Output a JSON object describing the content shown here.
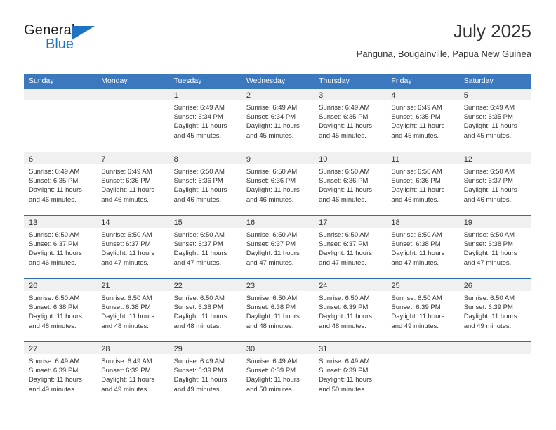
{
  "logo": {
    "word_top": "General",
    "word_bottom": "Blue",
    "icon": "triangle-mark",
    "accent_color": "#1f73c4"
  },
  "header": {
    "title": "July 2025",
    "subtitle": "Panguna, Bougainville, Papua New Guinea"
  },
  "colors": {
    "header_blue": "#3c78be",
    "row_divider_blue": "#2e6cb0",
    "day_band_gray": "#f0f0f0",
    "text": "#333333"
  },
  "weekdays": [
    "Sunday",
    "Monday",
    "Tuesday",
    "Wednesday",
    "Thursday",
    "Friday",
    "Saturday"
  ],
  "weeks": [
    [
      {
        "day": "",
        "empty": true,
        "sunrise": "",
        "sunset": "",
        "daylight_line1": "",
        "daylight_line2": ""
      },
      {
        "day": "",
        "empty": true,
        "sunrise": "",
        "sunset": "",
        "daylight_line1": "",
        "daylight_line2": ""
      },
      {
        "day": "1",
        "sunrise": "Sunrise: 6:49 AM",
        "sunset": "Sunset: 6:34 PM",
        "daylight_line1": "Daylight: 11 hours",
        "daylight_line2": "and 45 minutes."
      },
      {
        "day": "2",
        "sunrise": "Sunrise: 6:49 AM",
        "sunset": "Sunset: 6:34 PM",
        "daylight_line1": "Daylight: 11 hours",
        "daylight_line2": "and 45 minutes."
      },
      {
        "day": "3",
        "sunrise": "Sunrise: 6:49 AM",
        "sunset": "Sunset: 6:35 PM",
        "daylight_line1": "Daylight: 11 hours",
        "daylight_line2": "and 45 minutes."
      },
      {
        "day": "4",
        "sunrise": "Sunrise: 6:49 AM",
        "sunset": "Sunset: 6:35 PM",
        "daylight_line1": "Daylight: 11 hours",
        "daylight_line2": "and 45 minutes."
      },
      {
        "day": "5",
        "sunrise": "Sunrise: 6:49 AM",
        "sunset": "Sunset: 6:35 PM",
        "daylight_line1": "Daylight: 11 hours",
        "daylight_line2": "and 45 minutes."
      }
    ],
    [
      {
        "day": "6",
        "sunrise": "Sunrise: 6:49 AM",
        "sunset": "Sunset: 6:35 PM",
        "daylight_line1": "Daylight: 11 hours",
        "daylight_line2": "and 46 minutes."
      },
      {
        "day": "7",
        "sunrise": "Sunrise: 6:49 AM",
        "sunset": "Sunset: 6:36 PM",
        "daylight_line1": "Daylight: 11 hours",
        "daylight_line2": "and 46 minutes."
      },
      {
        "day": "8",
        "sunrise": "Sunrise: 6:50 AM",
        "sunset": "Sunset: 6:36 PM",
        "daylight_line1": "Daylight: 11 hours",
        "daylight_line2": "and 46 minutes."
      },
      {
        "day": "9",
        "sunrise": "Sunrise: 6:50 AM",
        "sunset": "Sunset: 6:36 PM",
        "daylight_line1": "Daylight: 11 hours",
        "daylight_line2": "and 46 minutes."
      },
      {
        "day": "10",
        "sunrise": "Sunrise: 6:50 AM",
        "sunset": "Sunset: 6:36 PM",
        "daylight_line1": "Daylight: 11 hours",
        "daylight_line2": "and 46 minutes."
      },
      {
        "day": "11",
        "sunrise": "Sunrise: 6:50 AM",
        "sunset": "Sunset: 6:36 PM",
        "daylight_line1": "Daylight: 11 hours",
        "daylight_line2": "and 46 minutes."
      },
      {
        "day": "12",
        "sunrise": "Sunrise: 6:50 AM",
        "sunset": "Sunset: 6:37 PM",
        "daylight_line1": "Daylight: 11 hours",
        "daylight_line2": "and 46 minutes."
      }
    ],
    [
      {
        "day": "13",
        "sunrise": "Sunrise: 6:50 AM",
        "sunset": "Sunset: 6:37 PM",
        "daylight_line1": "Daylight: 11 hours",
        "daylight_line2": "and 46 minutes."
      },
      {
        "day": "14",
        "sunrise": "Sunrise: 6:50 AM",
        "sunset": "Sunset: 6:37 PM",
        "daylight_line1": "Daylight: 11 hours",
        "daylight_line2": "and 47 minutes."
      },
      {
        "day": "15",
        "sunrise": "Sunrise: 6:50 AM",
        "sunset": "Sunset: 6:37 PM",
        "daylight_line1": "Daylight: 11 hours",
        "daylight_line2": "and 47 minutes."
      },
      {
        "day": "16",
        "sunrise": "Sunrise: 6:50 AM",
        "sunset": "Sunset: 6:37 PM",
        "daylight_line1": "Daylight: 11 hours",
        "daylight_line2": "and 47 minutes."
      },
      {
        "day": "17",
        "sunrise": "Sunrise: 6:50 AM",
        "sunset": "Sunset: 6:37 PM",
        "daylight_line1": "Daylight: 11 hours",
        "daylight_line2": "and 47 minutes."
      },
      {
        "day": "18",
        "sunrise": "Sunrise: 6:50 AM",
        "sunset": "Sunset: 6:38 PM",
        "daylight_line1": "Daylight: 11 hours",
        "daylight_line2": "and 47 minutes."
      },
      {
        "day": "19",
        "sunrise": "Sunrise: 6:50 AM",
        "sunset": "Sunset: 6:38 PM",
        "daylight_line1": "Daylight: 11 hours",
        "daylight_line2": "and 47 minutes."
      }
    ],
    [
      {
        "day": "20",
        "sunrise": "Sunrise: 6:50 AM",
        "sunset": "Sunset: 6:38 PM",
        "daylight_line1": "Daylight: 11 hours",
        "daylight_line2": "and 48 minutes."
      },
      {
        "day": "21",
        "sunrise": "Sunrise: 6:50 AM",
        "sunset": "Sunset: 6:38 PM",
        "daylight_line1": "Daylight: 11 hours",
        "daylight_line2": "and 48 minutes."
      },
      {
        "day": "22",
        "sunrise": "Sunrise: 6:50 AM",
        "sunset": "Sunset: 6:38 PM",
        "daylight_line1": "Daylight: 11 hours",
        "daylight_line2": "and 48 minutes."
      },
      {
        "day": "23",
        "sunrise": "Sunrise: 6:50 AM",
        "sunset": "Sunset: 6:38 PM",
        "daylight_line1": "Daylight: 11 hours",
        "daylight_line2": "and 48 minutes."
      },
      {
        "day": "24",
        "sunrise": "Sunrise: 6:50 AM",
        "sunset": "Sunset: 6:39 PM",
        "daylight_line1": "Daylight: 11 hours",
        "daylight_line2": "and 48 minutes."
      },
      {
        "day": "25",
        "sunrise": "Sunrise: 6:50 AM",
        "sunset": "Sunset: 6:39 PM",
        "daylight_line1": "Daylight: 11 hours",
        "daylight_line2": "and 49 minutes."
      },
      {
        "day": "26",
        "sunrise": "Sunrise: 6:50 AM",
        "sunset": "Sunset: 6:39 PM",
        "daylight_line1": "Daylight: 11 hours",
        "daylight_line2": "and 49 minutes."
      }
    ],
    [
      {
        "day": "27",
        "sunrise": "Sunrise: 6:49 AM",
        "sunset": "Sunset: 6:39 PM",
        "daylight_line1": "Daylight: 11 hours",
        "daylight_line2": "and 49 minutes."
      },
      {
        "day": "28",
        "sunrise": "Sunrise: 6:49 AM",
        "sunset": "Sunset: 6:39 PM",
        "daylight_line1": "Daylight: 11 hours",
        "daylight_line2": "and 49 minutes."
      },
      {
        "day": "29",
        "sunrise": "Sunrise: 6:49 AM",
        "sunset": "Sunset: 6:39 PM",
        "daylight_line1": "Daylight: 11 hours",
        "daylight_line2": "and 49 minutes."
      },
      {
        "day": "30",
        "sunrise": "Sunrise: 6:49 AM",
        "sunset": "Sunset: 6:39 PM",
        "daylight_line1": "Daylight: 11 hours",
        "daylight_line2": "and 50 minutes."
      },
      {
        "day": "31",
        "sunrise": "Sunrise: 6:49 AM",
        "sunset": "Sunset: 6:39 PM",
        "daylight_line1": "Daylight: 11 hours",
        "daylight_line2": "and 50 minutes."
      },
      {
        "day": "",
        "empty": true,
        "sunrise": "",
        "sunset": "",
        "daylight_line1": "",
        "daylight_line2": ""
      },
      {
        "day": "",
        "empty": true,
        "sunrise": "",
        "sunset": "",
        "daylight_line1": "",
        "daylight_line2": ""
      }
    ]
  ]
}
